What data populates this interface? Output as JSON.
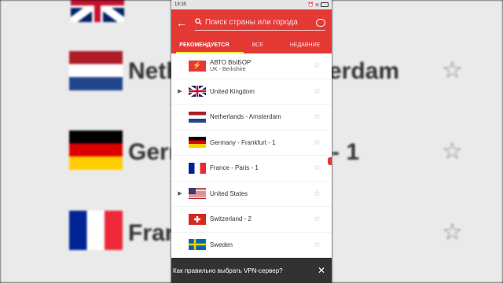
{
  "status_bar": {
    "time": "19:35"
  },
  "toolbar": {
    "search_placeholder": "Поиск страны или города"
  },
  "tabs": [
    {
      "label": "РЕКОМЕНДУЕТСЯ",
      "active": true
    },
    {
      "label": "ВСЕ",
      "active": false
    },
    {
      "label": "НЕДАВНИЕ",
      "active": false
    }
  ],
  "servers": [
    {
      "label": "АВТО ВЫБОР",
      "sub": "UK - Berkshire",
      "flag": "auto",
      "expandable": false
    },
    {
      "label": "United Kingdom",
      "flag": "uk",
      "expandable": true
    },
    {
      "label": "Netherlands - Amsterdam",
      "flag": "nl",
      "expandable": false
    },
    {
      "label": "Germany - Frankfurt - 1",
      "flag": "de",
      "expandable": false
    },
    {
      "label": "France - Paris - 1",
      "flag": "fr",
      "expandable": false
    },
    {
      "label": "United States",
      "flag": "us",
      "expandable": true
    },
    {
      "label": "Switzerland - 2",
      "flag": "ch",
      "expandable": false
    },
    {
      "label": "Sweden",
      "flag": "se",
      "expandable": false
    }
  ],
  "snackbar": {
    "text": "Как правильно выбрать VPN-сервер?"
  },
  "background_zoom": {
    "items": [
      {
        "text": "Netherlands - Amsterdam",
        "visible_left": "Neth",
        "visible_right": "erdam"
      },
      {
        "text": "Germany - Frankfurt - 1",
        "visible_left": "Gern",
        "visible_right": "- 1"
      },
      {
        "text": "France - Paris - 1",
        "visible_left": "Fran",
        "visible_right": ""
      }
    ]
  },
  "colors": {
    "accent": "#e53935",
    "tab_indicator": "#ffeb3b",
    "snackbar": "#323232"
  }
}
